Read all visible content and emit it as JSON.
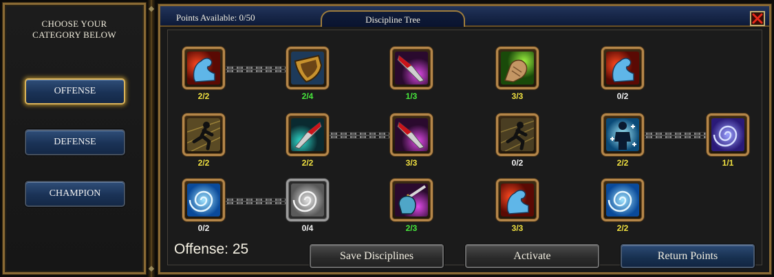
{
  "left_panel": {
    "title": "CHOOSE YOUR\nCATEGORY BELOW",
    "categories": [
      {
        "label": "OFFENSE",
        "active": true
      },
      {
        "label": "DEFENSE",
        "active": false
      },
      {
        "label": "CHAMPION",
        "active": false
      }
    ]
  },
  "header": {
    "points_available": "Points Available: 0/50",
    "tab_title": "Discipline Tree",
    "close_icon": "close-x-icon"
  },
  "colors": {
    "rank_max": "#f0e040",
    "rank_partial": "#48e83c",
    "rank_zero": "#f2f2f2",
    "button_blue": "#1a3256",
    "frame_gold": "#8a6a34"
  },
  "skills": [
    {
      "row": 1,
      "col": 1,
      "icon": "flexing-arm-icon",
      "rank": "2/2"
    },
    {
      "row": 1,
      "col": 2,
      "icon": "shield-icon",
      "rank": "2/4"
    },
    {
      "row": 1,
      "col": 3,
      "icon": "bloody-blade-icon",
      "rank": "1/3"
    },
    {
      "row": 1,
      "col": 4,
      "icon": "fist-icon",
      "rank": "3/3"
    },
    {
      "row": 1,
      "col": 5,
      "icon": "flexing-arm-icon",
      "rank": "0/2"
    },
    {
      "row": 2,
      "col": 1,
      "icon": "running-silhouette-icon",
      "rank": "2/2"
    },
    {
      "row": 2,
      "col": 2,
      "icon": "bloody-blade-icon",
      "rank": "2/2"
    },
    {
      "row": 2,
      "col": 3,
      "icon": "bloody-blade-icon",
      "rank": "3/3"
    },
    {
      "row": 2,
      "col": 4,
      "icon": "running-silhouette-icon",
      "rank": "0/2"
    },
    {
      "row": 2,
      "col": 5,
      "icon": "glowing-figure-icon",
      "rank": "2/2"
    },
    {
      "row": 2,
      "col": 6,
      "icon": "purple-swirl-icon",
      "rank": "1/1"
    },
    {
      "row": 3,
      "col": 1,
      "icon": "blue-swirl-icon",
      "rank": "0/2"
    },
    {
      "row": 3,
      "col": 2,
      "icon": "grey-swirl-icon",
      "rank": "0/4"
    },
    {
      "row": 3,
      "col": 3,
      "icon": "fist-with-sword-icon",
      "rank": "2/3"
    },
    {
      "row": 3,
      "col": 4,
      "icon": "flexing-arm-icon",
      "rank": "3/3"
    },
    {
      "row": 3,
      "col": 5,
      "icon": "blue-swirl-icon",
      "rank": "2/2"
    }
  ],
  "footer": {
    "offense_total": "Offense: 25",
    "save_label": "Save Disciplines",
    "activate_label": "Activate",
    "return_label": "Return Points"
  }
}
